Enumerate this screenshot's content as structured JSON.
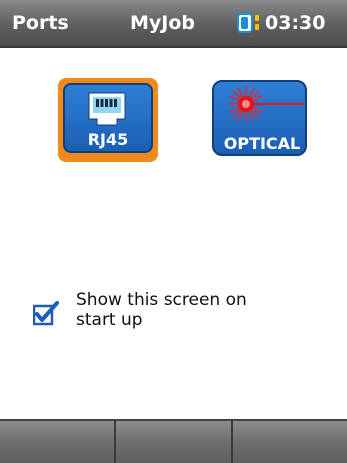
{
  "header": {
    "left_label": "Ports",
    "center_label": "MyJob",
    "time": "03:30",
    "battery_icon": "battery-icon"
  },
  "ports": [
    {
      "label": "RJ45",
      "icon": "ethernet-port-icon",
      "selected": true
    },
    {
      "label": "OPTICAL",
      "icon": "laser-icon",
      "selected": false
    }
  ],
  "startup": {
    "line1": "Show this screen on",
    "line2": "start up",
    "checked": true
  },
  "colors": {
    "accent_blue": "#1b5fb3",
    "selection_orange": "#f08a1e",
    "laser_red": "#e8121a",
    "titlebar_gray": "#5e5e5e"
  },
  "softkeys": [
    "",
    "",
    ""
  ]
}
